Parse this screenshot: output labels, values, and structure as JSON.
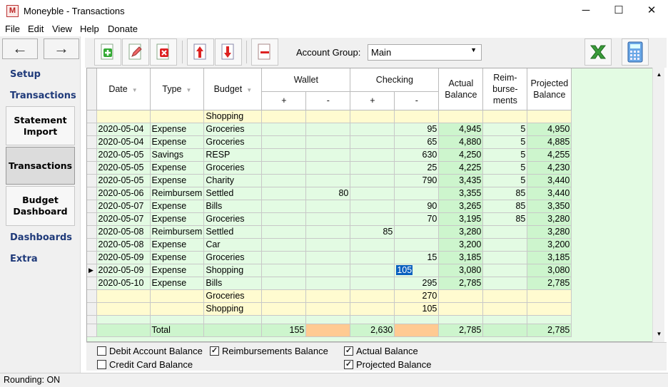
{
  "window": {
    "app_icon_glyph": "M",
    "title": "Moneyble - Transactions",
    "minimize": "─",
    "maximize": "☐",
    "close": "✕"
  },
  "menu": {
    "file": "File",
    "edit": "Edit",
    "view": "View",
    "help": "Help",
    "donate": "Donate"
  },
  "nav": {
    "back": "←",
    "forward": "→",
    "setup": "Setup",
    "transactions": "Transactions",
    "statement_import": "Statement Import",
    "transactions_btn": "Transactions",
    "budget_dashboard": "Budget Dashboard",
    "dashboards": "Dashboards",
    "extra": "Extra"
  },
  "toolbar": {
    "account_group_label": "Account Group:",
    "account_group_value": "Main",
    "icons": [
      "add-icon",
      "edit-icon",
      "delete-icon",
      "move-up-icon",
      "move-down-icon",
      "remove-icon",
      "excel-icon",
      "calculator-icon"
    ]
  },
  "grid": {
    "headers": {
      "date": "Date",
      "type": "Type",
      "budget": "Budget",
      "wallet": "Wallet",
      "checking": "Checking",
      "plus": "+",
      "minus": "-",
      "actual": "Actual Balance",
      "reimb": "Reim- burse- ments",
      "projected": "Projected Balance"
    },
    "rows": [
      {
        "date": "",
        "type": "",
        "budget": "Shopping",
        "w_plus": "",
        "w_minus": "",
        "c_plus": "",
        "c_minus": "",
        "actual": "",
        "reimb": "",
        "projected": "",
        "style": "yellow"
      },
      {
        "date": "2020-05-04",
        "type": "Expense",
        "budget": "Groceries",
        "w_plus": "",
        "w_minus": "",
        "c_plus": "",
        "c_minus": "95",
        "actual": "4,945",
        "reimb": "5",
        "projected": "4,950"
      },
      {
        "date": "2020-05-04",
        "type": "Expense",
        "budget": "Groceries",
        "w_plus": "",
        "w_minus": "",
        "c_plus": "",
        "c_minus": "65",
        "actual": "4,880",
        "reimb": "5",
        "projected": "4,885"
      },
      {
        "date": "2020-05-05",
        "type": "Savings",
        "budget": "RESP",
        "w_plus": "",
        "w_minus": "",
        "c_plus": "",
        "c_minus": "630",
        "actual": "4,250",
        "reimb": "5",
        "projected": "4,255"
      },
      {
        "date": "2020-05-05",
        "type": "Expense",
        "budget": "Groceries",
        "w_plus": "",
        "w_minus": "",
        "c_plus": "",
        "c_minus": "25",
        "actual": "4,225",
        "reimb": "5",
        "projected": "4,230"
      },
      {
        "date": "2020-05-05",
        "type": "Expense",
        "budget": "Charity",
        "w_plus": "",
        "w_minus": "",
        "c_plus": "",
        "c_minus": "790",
        "actual": "3,435",
        "reimb": "5",
        "projected": "3,440"
      },
      {
        "date": "2020-05-06",
        "type": "Reimbursem",
        "budget": "Settled",
        "w_plus": "",
        "w_minus": "80",
        "c_plus": "",
        "c_minus": "",
        "actual": "3,355",
        "reimb": "85",
        "projected": "3,440"
      },
      {
        "date": "2020-05-07",
        "type": "Expense",
        "budget": "Bills",
        "w_plus": "",
        "w_minus": "",
        "c_plus": "",
        "c_minus": "90",
        "actual": "3,265",
        "reimb": "85",
        "projected": "3,350"
      },
      {
        "date": "2020-05-07",
        "type": "Expense",
        "budget": "Groceries",
        "w_plus": "",
        "w_minus": "",
        "c_plus": "",
        "c_minus": "70",
        "actual": "3,195",
        "reimb": "85",
        "projected": "3,280"
      },
      {
        "date": "2020-05-08",
        "type": "Reimbursem",
        "budget": "Settled",
        "w_plus": "",
        "w_minus": "",
        "c_plus": "85",
        "c_minus": "",
        "actual": "3,280",
        "reimb": "",
        "projected": "3,280"
      },
      {
        "date": "2020-05-08",
        "type": "Expense",
        "budget": "Car",
        "w_plus": "",
        "w_minus": "",
        "c_plus": "",
        "c_minus": "",
        "actual": "3,200",
        "reimb": "",
        "projected": "3,200"
      },
      {
        "date": "2020-05-09",
        "type": "Expense",
        "budget": "Groceries",
        "w_plus": "",
        "w_minus": "",
        "c_plus": "",
        "c_minus": "15",
        "actual": "3,185",
        "reimb": "",
        "projected": "3,185"
      },
      {
        "date": "2020-05-09",
        "type": "Expense",
        "budget": "Shopping",
        "w_plus": "",
        "w_minus": "",
        "c_plus": "",
        "c_minus": "105",
        "actual": "3,080",
        "reimb": "",
        "projected": "3,080",
        "current": true
      },
      {
        "date": "2020-05-10",
        "type": "Expense",
        "budget": "Bills",
        "w_plus": "",
        "w_minus": "",
        "c_plus": "",
        "c_minus": "295",
        "actual": "2,785",
        "reimb": "",
        "projected": "2,785"
      },
      {
        "date": "",
        "type": "",
        "budget": "Groceries",
        "w_plus": "",
        "w_minus": "",
        "c_plus": "",
        "c_minus": "270",
        "actual": "",
        "reimb": "",
        "projected": "",
        "style": "yellow"
      },
      {
        "date": "",
        "type": "",
        "budget": "Shopping",
        "w_plus": "",
        "w_minus": "",
        "c_plus": "",
        "c_minus": "105",
        "actual": "",
        "reimb": "",
        "projected": "",
        "style": "yellow"
      }
    ],
    "current_row_marker": "▶",
    "total": {
      "label": "Total",
      "w_plus": "155",
      "c_plus": "2,630",
      "actual": "2,785",
      "projected": "2,785"
    }
  },
  "checks": {
    "debit": "Debit Account Balance",
    "credit": "Credit Card Balance",
    "reimb": "Reimbursements Balance",
    "actual": "Actual Balance",
    "projected": "Projected Balance",
    "debit_checked": false,
    "credit_checked": false,
    "reimb_checked": true,
    "actual_checked": true,
    "projected_checked": true
  },
  "status": {
    "rounding": "Rounding: ON"
  },
  "colors": {
    "grid_bg": "#e3fbe3",
    "highlight_yellow": "#fffbd0",
    "balance_green": "#cdf5cd",
    "total_orange": "#ffca92",
    "nav_heading": "#1f3a7a",
    "selection": "#0a5fbf"
  }
}
